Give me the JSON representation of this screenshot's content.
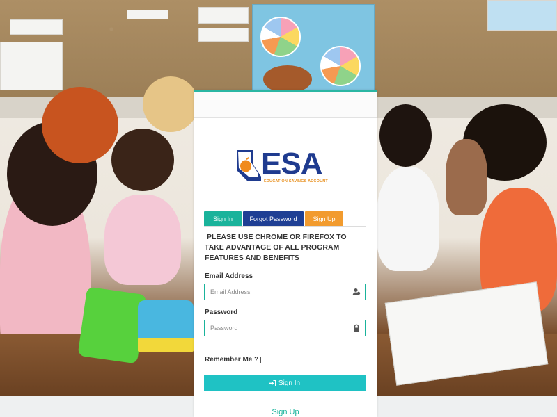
{
  "logo": {
    "text": "ESA",
    "tagline": "EDUCATION SAVINGS ACCOUNT",
    "icon": "nevada-apple-logo-icon"
  },
  "tabs": [
    {
      "label": "Sign In",
      "color": "#1ab39b"
    },
    {
      "label": "Forgot Password",
      "color": "#1f3f94"
    },
    {
      "label": "Sign Up",
      "color": "#f29b2e"
    }
  ],
  "notice": "PLEASE USE CHROME OR FIREFOX TO TAKE ADVANTAGE OF ALL PROGRAM FEATURES AND BENEFITS",
  "form": {
    "email_label": "Email Address",
    "email_placeholder": "Email Address",
    "email_value": "",
    "email_icon": "user-icon",
    "password_label": "Password",
    "password_placeholder": "Password",
    "password_value": "",
    "password_icon": "lock-icon",
    "remember_label": "Remember Me ?",
    "remember_checked": false,
    "signin_button": "Sign In",
    "signin_icon": "sign-in-icon"
  },
  "signup_link": "Sign Up",
  "colors": {
    "accent_teal": "#1ab39b",
    "navy": "#1f3f94",
    "orange": "#f29b2e",
    "button_cyan": "#1fc2c4"
  }
}
